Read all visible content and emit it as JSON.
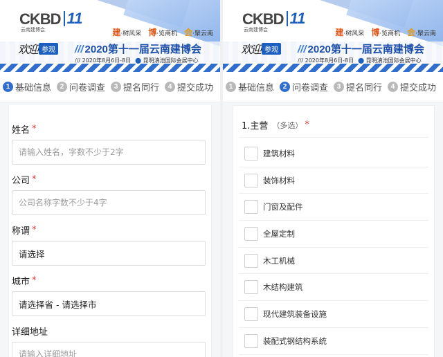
{
  "banner": {
    "logo_text": "CKBD",
    "logo_number": "11",
    "logo_sub": "云南建博会",
    "slogan_1_mark": "建",
    "slogan_1": "·树风采",
    "slogan_2_mark": "博",
    "slogan_2": "·览商机",
    "slogan_3_mark": "会",
    "slogan_3": "·聚云南",
    "welcome_hand": "欢迎",
    "welcome_tag": "参观",
    "expo_title_slashes": "///",
    "expo_title": "2020第十一届云南建博会",
    "expo_date": "/// 2020年8月6日-8日",
    "expo_venue": "昆明滇池国际会展中心"
  },
  "steps": [
    {
      "num": "1",
      "label": "基础信息"
    },
    {
      "num": "2",
      "label": "问卷调查"
    },
    {
      "num": "3",
      "label": "提名同行"
    },
    {
      "num": "4",
      "label": "提交成功"
    }
  ],
  "form": {
    "name_label": "姓名",
    "name_placeholder": "请输入姓名，字数不少于2字",
    "company_label": "公司",
    "company_placeholder": "公司名称字数不少于4字",
    "title_label": "称谓",
    "title_value": "请选择",
    "city_label": "城市",
    "city_value": "请选择省 - 请选择市",
    "address_label": "详细地址",
    "address_placeholder": "请输入详细地址",
    "required_mark": "*"
  },
  "survey": {
    "question_title": "1.主营",
    "question_type": "（多选）",
    "required_mark": "*",
    "options": [
      "建筑材料",
      "装饰材料",
      "门窗及配件",
      "全屋定制",
      "木工机械",
      "木结构建筑",
      "现代建筑装备设施",
      "装配式钢结构系统"
    ]
  },
  "colors": {
    "accent": "#2f6ecf",
    "required": "#e23b3b",
    "step_inactive": "#b9b9b9"
  }
}
